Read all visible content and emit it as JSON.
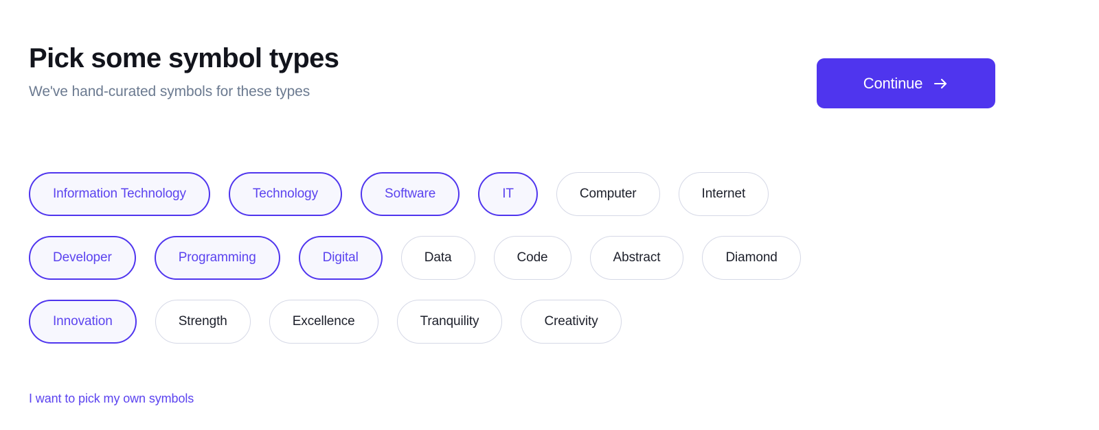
{
  "header": {
    "title": "Pick some symbol types",
    "subtitle": "We've hand-curated symbols for these types"
  },
  "actions": {
    "continue_label": "Continue",
    "continue_icon": "arrow-right-icon",
    "own_symbols_link": "I want to pick my own symbols"
  },
  "colors": {
    "accent": "#4f35ee",
    "accent_text": "#5b43ef",
    "selected_fill": "#f7f7fe",
    "chip_border": "#d5d8e6",
    "title": "#12141c",
    "subtitle": "#6b7a90"
  },
  "chip_rows": [
    [
      {
        "label": "Information Technology",
        "selected": true
      },
      {
        "label": "Technology",
        "selected": true
      },
      {
        "label": "Software",
        "selected": true
      },
      {
        "label": "IT",
        "selected": true
      },
      {
        "label": "Computer",
        "selected": false
      },
      {
        "label": "Internet",
        "selected": false
      }
    ],
    [
      {
        "label": "Developer",
        "selected": true
      },
      {
        "label": "Programming",
        "selected": true
      },
      {
        "label": "Digital",
        "selected": true
      },
      {
        "label": "Data",
        "selected": false
      },
      {
        "label": "Code",
        "selected": false
      },
      {
        "label": "Abstract",
        "selected": false
      },
      {
        "label": "Diamond",
        "selected": false
      }
    ],
    [
      {
        "label": "Innovation",
        "selected": true
      },
      {
        "label": "Strength",
        "selected": false
      },
      {
        "label": "Excellence",
        "selected": false
      },
      {
        "label": "Tranquility",
        "selected": false
      },
      {
        "label": "Creativity",
        "selected": false
      }
    ]
  ]
}
